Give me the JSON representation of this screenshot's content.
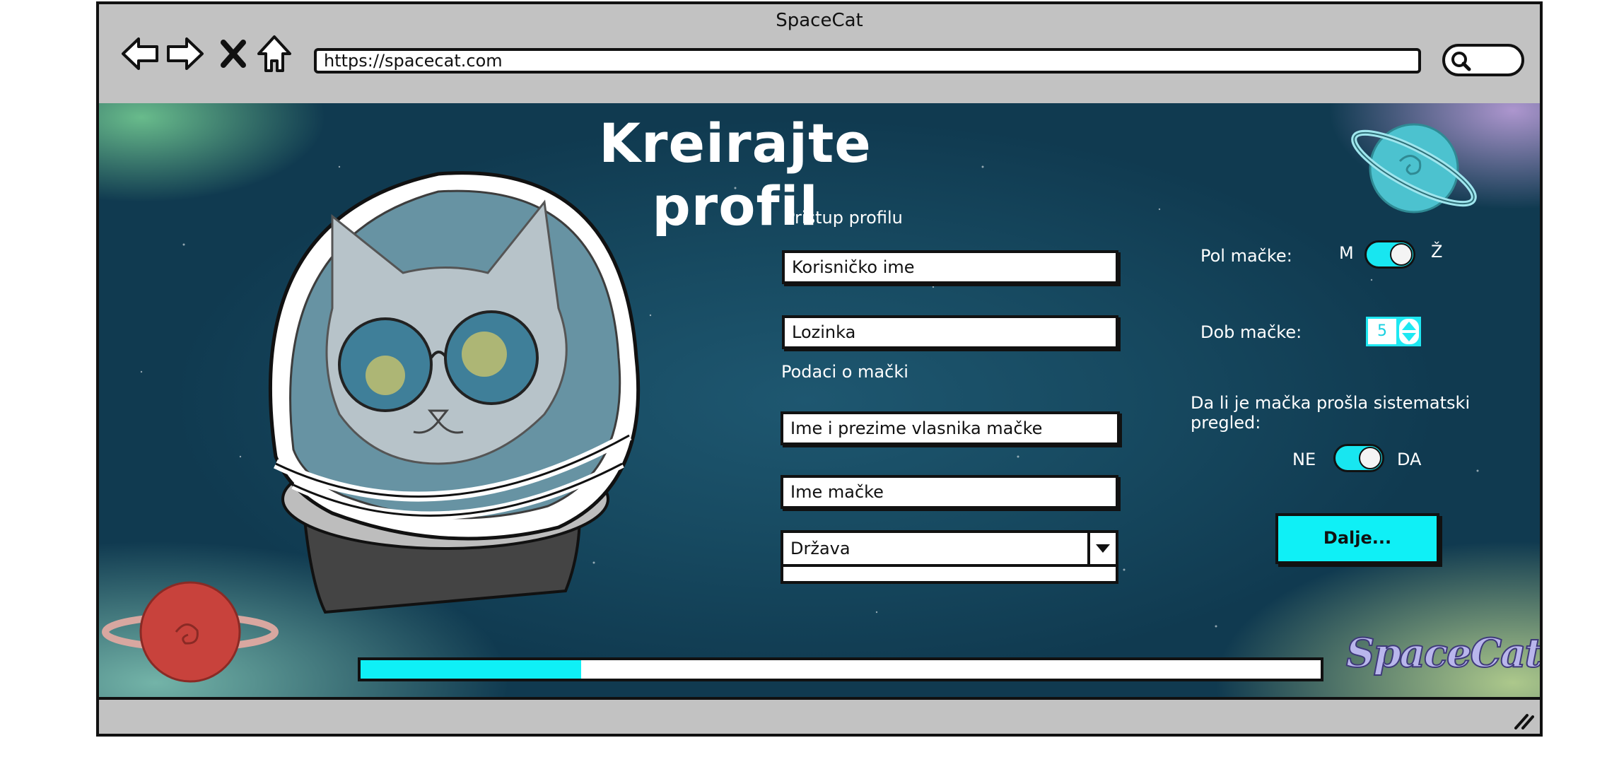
{
  "window": {
    "title": "SpaceCat"
  },
  "toolbar": {
    "back_icon": "back-arrow-icon",
    "forward_icon": "forward-arrow-icon",
    "stop_icon": "close-icon",
    "home_icon": "home-icon",
    "search_icon": "search-icon"
  },
  "address_bar": {
    "url": "https://spacecat.com"
  },
  "page": {
    "title": "Kreirajte profil",
    "profile_section": {
      "label": "Pristup profilu",
      "username_placeholder": "Korisničko ime",
      "password_placeholder": "Lozinka"
    },
    "cat_section": {
      "label": "Podaci o mački",
      "owner_placeholder": "Ime i prezime vlasnika mačke",
      "cat_name_placeholder": "Ime mačke",
      "country_select": {
        "selected": "Država"
      }
    },
    "gender": {
      "label": "Pol mačke:",
      "left_option": "M",
      "right_option": "Ž",
      "selected": "Ž"
    },
    "age": {
      "label": "Dob mačke:",
      "value": "5"
    },
    "checkup": {
      "label": "Da li je mačka prošla sistematski pregled:",
      "left_option": "NE",
      "right_option": "DA",
      "selected": "DA"
    },
    "next_button": "Dalje...",
    "progress_fraction": 0.23,
    "logo_text": "SpaceCat"
  },
  "colors": {
    "accent": "#0ff0f6",
    "background": "#174a61",
    "chrome": "#c2c2c2"
  }
}
